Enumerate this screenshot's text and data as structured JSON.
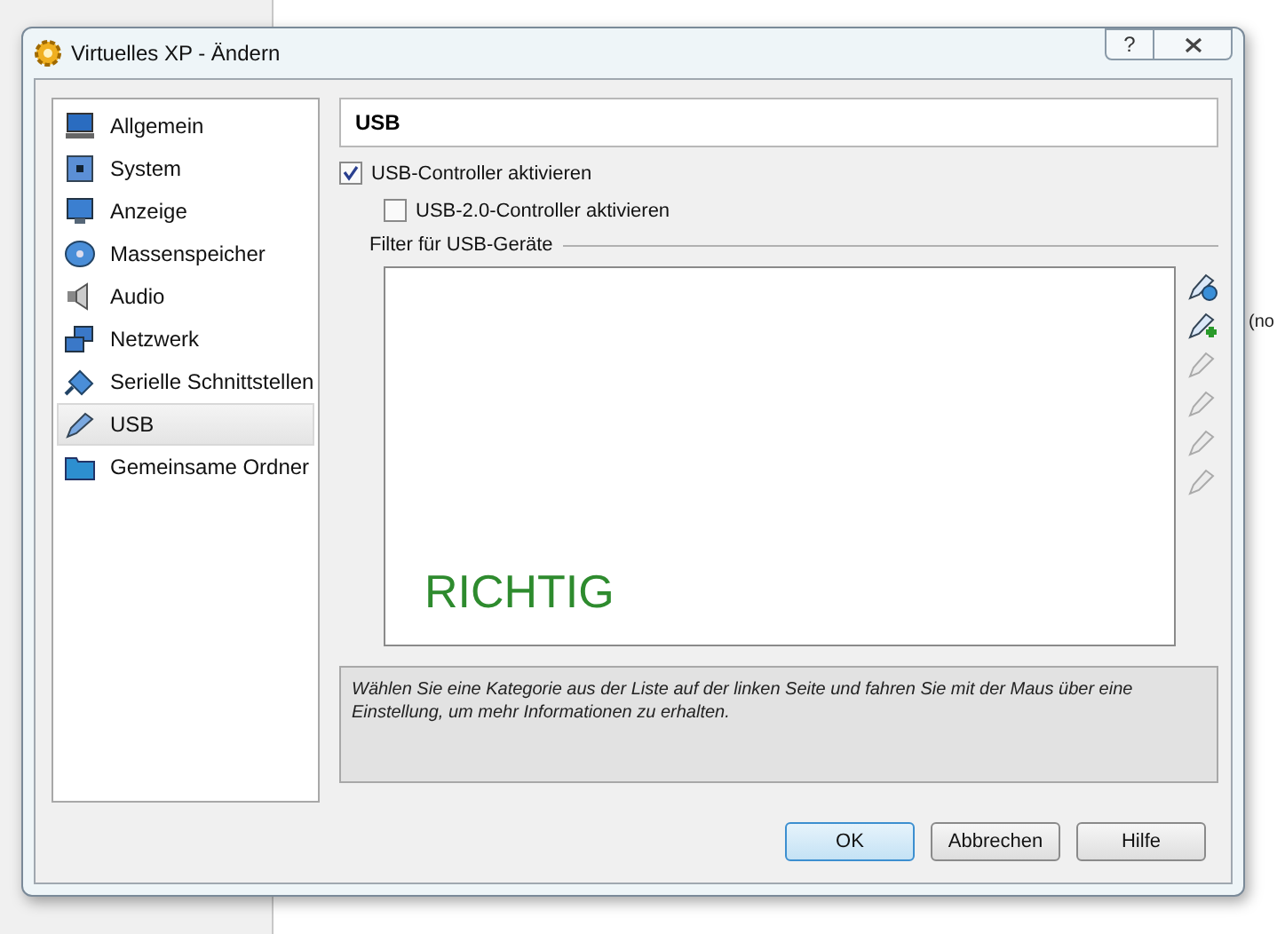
{
  "background": {
    "text": "(no"
  },
  "window": {
    "title": "Virtuelles XP - Ändern",
    "help": "?"
  },
  "sidebar": {
    "items": [
      {
        "label": "Allgemein",
        "selected": false
      },
      {
        "label": "System",
        "selected": false
      },
      {
        "label": "Anzeige",
        "selected": false
      },
      {
        "label": "Massenspeicher",
        "selected": false
      },
      {
        "label": "Audio",
        "selected": false
      },
      {
        "label": "Netzwerk",
        "selected": false
      },
      {
        "label": "Serielle Schnittstellen",
        "selected": false
      },
      {
        "label": "USB",
        "selected": true
      },
      {
        "label": "Gemeinsame Ordner",
        "selected": false
      }
    ]
  },
  "page": {
    "title": "USB",
    "checkboxes": [
      {
        "label": "USB-Controller aktivieren",
        "checked": true
      },
      {
        "label": "USB-2.0-Controller aktivieren",
        "checked": false
      }
    ],
    "filter_group": "Filter für USB-Geräte",
    "overlay_text": "RICHTIG",
    "tools": [
      {
        "disabled": false
      },
      {
        "disabled": false
      },
      {
        "disabled": true
      },
      {
        "disabled": true
      },
      {
        "disabled": true
      },
      {
        "disabled": true
      }
    ],
    "info": "Wählen Sie eine Kategorie aus der Liste auf der linken Seite und fahren Sie mit der Maus über eine Einstellung, um mehr Informationen zu erhalten."
  },
  "buttons": [
    {
      "label": "OK",
      "selected": true
    },
    {
      "label": "Abbrechen",
      "selected": false
    },
    {
      "label": "Hilfe",
      "selected": false
    }
  ]
}
